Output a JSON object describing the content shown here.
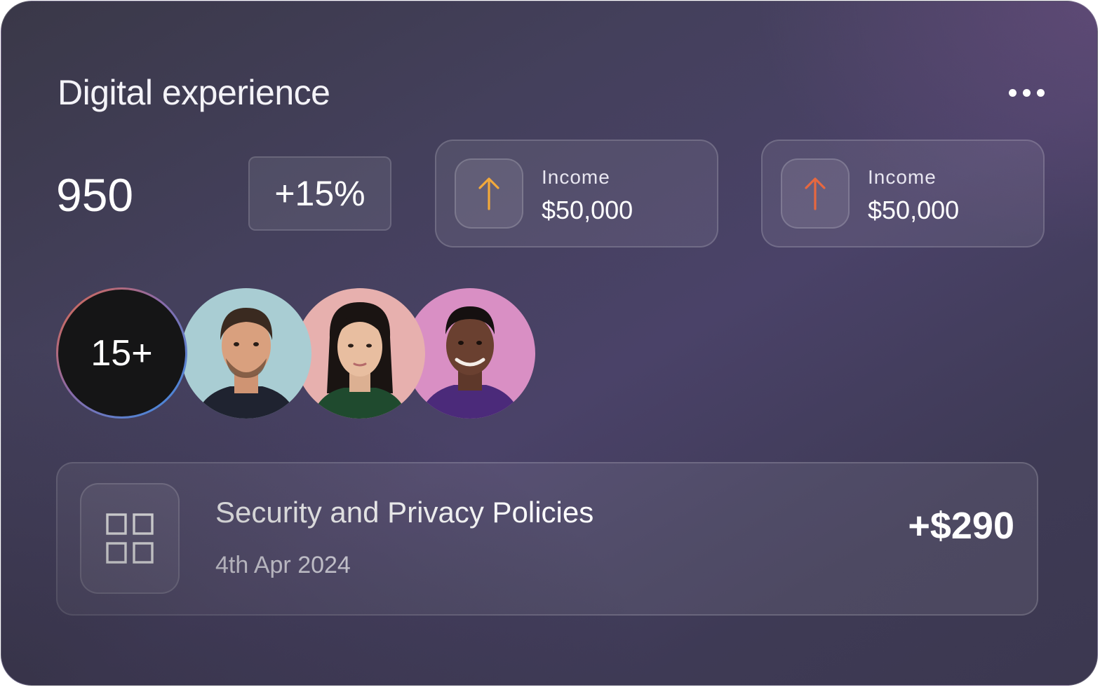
{
  "card": {
    "title": "Digital experience",
    "more_icon": "more-horizontal-icon"
  },
  "metrics": {
    "count": "950",
    "change": "+15%"
  },
  "stats": [
    {
      "label": "Income",
      "value": "$50,000",
      "icon": "arrow-up-icon",
      "accent": "#f2a93b"
    },
    {
      "label": "Income",
      "value": "$50,000",
      "icon": "arrow-up-icon",
      "accent": "#e8683f"
    }
  ],
  "team": {
    "count_label": "15+",
    "members": [
      {
        "bg": "#a9cdd3",
        "skin": "#d9a07e",
        "hair": "#3a2a20",
        "shirt": "#1f2330"
      },
      {
        "bg": "#e7b0ae",
        "skin": "#e8bea0",
        "hair": "#1a1412",
        "shirt": "#1f4a2e"
      },
      {
        "bg": "#d98fc4",
        "skin": "#6a4030",
        "hair": "#151010",
        "shirt": "#4b2a7a"
      }
    ]
  },
  "policy": {
    "icon": "grid-icon",
    "title": "Security and Privacy Policies",
    "date": "4th Apr 2024",
    "amount": "+$290"
  }
}
